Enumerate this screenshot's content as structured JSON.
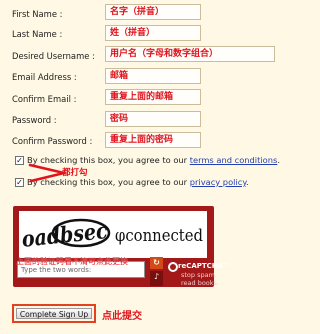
{
  "form": {
    "fields": [
      {
        "label": "First Name :",
        "annotation": "名字（拼音）"
      },
      {
        "label": "Last Name :",
        "annotation": "姓（拼音）"
      },
      {
        "label": "Desired Username :",
        "annotation": "用户名（字母和数字组合）"
      },
      {
        "label": "Email Address :",
        "annotation": "邮箱"
      },
      {
        "label": "Confirm Email :",
        "annotation": "重复上面的邮箱"
      },
      {
        "label": "Password :",
        "annotation": "密码"
      },
      {
        "label": "Confirm Password :",
        "annotation": "重复上面的密码"
      }
    ],
    "terms": {
      "prefix": "By checking this box, you agree to our ",
      "link": "terms and conditions",
      "suffix": ".",
      "checked": true
    },
    "privacy": {
      "prefix": "By checking this box, you agree to our ",
      "link": "privacy policy",
      "suffix": ".",
      "checked": true
    },
    "check_annotation": "都打勾",
    "captcha": {
      "word1": "oadbsec",
      "word2": "φconnected",
      "instruction": "上面的验证码看不清可点此更换",
      "input_placeholder": "Type the two words:",
      "brand": "reCAPTCHA™",
      "tagline1": "stop spam.",
      "tagline2": "read books."
    },
    "submit_label": "Complete Sign Up",
    "submit_annotation": "点此提交"
  },
  "colors": {
    "background": "#fef8e4",
    "annotation": "#e0141c",
    "link": "#243fae",
    "captcha_frame": "#a3191a"
  }
}
